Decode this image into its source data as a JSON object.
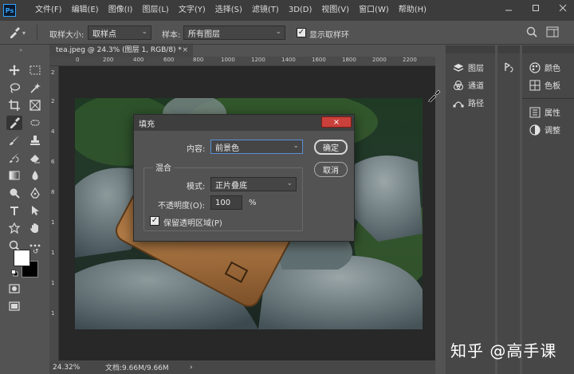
{
  "app": {
    "logo_text": "Ps"
  },
  "menu": [
    "文件(F)",
    "编辑(E)",
    "图像(I)",
    "图层(L)",
    "文字(Y)",
    "选择(S)",
    "滤镜(T)",
    "3D(D)",
    "视图(V)",
    "窗口(W)",
    "帮助(H)"
  ],
  "options": {
    "sample_size_label": "取样大小:",
    "sample_size_value": "取样点",
    "sample_label": "样本:",
    "sample_value": "所有图层",
    "show_ring_label": "显示取样环",
    "show_ring_checked": true
  },
  "document": {
    "tab_title": "tea.jpeg @ 24.3% (图层 1, RGB/8) *",
    "tab_close": "×",
    "ruler_h": [
      "0",
      "200",
      "400",
      "600",
      "800",
      "1000",
      "1200",
      "1400",
      "1600",
      "1800",
      "2000",
      "2200"
    ],
    "ruler_v": [
      "2",
      "2",
      "4",
      "6",
      "8",
      "1",
      "1",
      "1",
      "1"
    ],
    "zoom": "24.32%",
    "doc_info": "文档:9.66M/9.66M",
    "status_arrow": "›"
  },
  "panels": {
    "group1": [
      {
        "icon": "layers-icon",
        "label": "图层"
      },
      {
        "icon": "channels-icon",
        "label": "通道"
      },
      {
        "icon": "paths-icon",
        "label": "路径"
      }
    ],
    "group2": [
      {
        "icon": "color-icon",
        "label": "颜色"
      },
      {
        "icon": "swatches-icon",
        "label": "色板"
      },
      {
        "icon": "properties-icon",
        "label": "属性"
      },
      {
        "icon": "adjustments-icon",
        "label": "调整"
      }
    ]
  },
  "dialog": {
    "title": "填充",
    "close": "×",
    "content_label": "内容:",
    "content_value": "前景色",
    "blend_group": "混合",
    "mode_label": "模式:",
    "mode_value": "正片叠底",
    "opacity_label": "不透明度(O):",
    "opacity_value": "100",
    "opacity_unit": "%",
    "preserve_label": "保留透明区域(P)",
    "preserve_checked": true,
    "ok": "确定",
    "cancel": "取消"
  },
  "watermark": "知乎 @高手课",
  "colors": {
    "foreground": "#ffffff",
    "background": "#000000",
    "menubar": "#3c3c3c",
    "close_button": "#c9413a"
  }
}
